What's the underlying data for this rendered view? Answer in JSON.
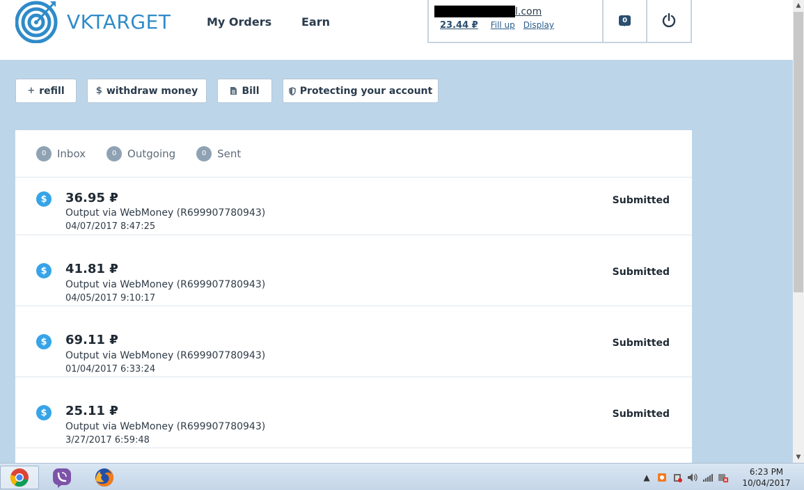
{
  "header": {
    "logo_text": "VKTARGET",
    "nav": [
      {
        "label": "My Orders"
      },
      {
        "label": "Earn"
      }
    ],
    "account": {
      "email_suffix": "l.com",
      "balance": "23.44 ₽",
      "fill_up": "Fill up",
      "display": "Display",
      "messages_count": "0"
    }
  },
  "actions": {
    "refill": "refill",
    "withdraw": "withdraw money",
    "bill": "Bill",
    "protect": "Protecting your account"
  },
  "tabs": [
    {
      "count": "0",
      "label": "Inbox"
    },
    {
      "count": "0",
      "label": "Outgoing"
    },
    {
      "count": "0",
      "label": "Sent"
    }
  ],
  "transactions": [
    {
      "amount": "36.95 ₽",
      "description": "Output via WebMoney (R699907780943)",
      "date": "04/07/2017 8:47:25",
      "status": "Submitted"
    },
    {
      "amount": "41.81 ₽",
      "description": "Output via WebMoney (R699907780943)",
      "date": "04/05/2017 9:10:17",
      "status": "Submitted"
    },
    {
      "amount": "69.11 ₽",
      "description": "Output via WebMoney (R699907780943)",
      "date": "01/04/2017 6:33:24",
      "status": "Submitted"
    },
    {
      "amount": "25.11 ₽",
      "description": "Output via WebMoney (R699907780943)",
      "date": "3/27/2017 6:59:48",
      "status": "Submitted"
    }
  ],
  "taskbar": {
    "apps": [
      "chrome-icon",
      "viber-icon",
      "firefox-icon"
    ],
    "time": "6:23 PM",
    "date": "10/04/2017"
  },
  "colors": {
    "accent": "#2f8bc9",
    "page_bg": "#bdd5e8",
    "coin": "#37a4e8"
  }
}
